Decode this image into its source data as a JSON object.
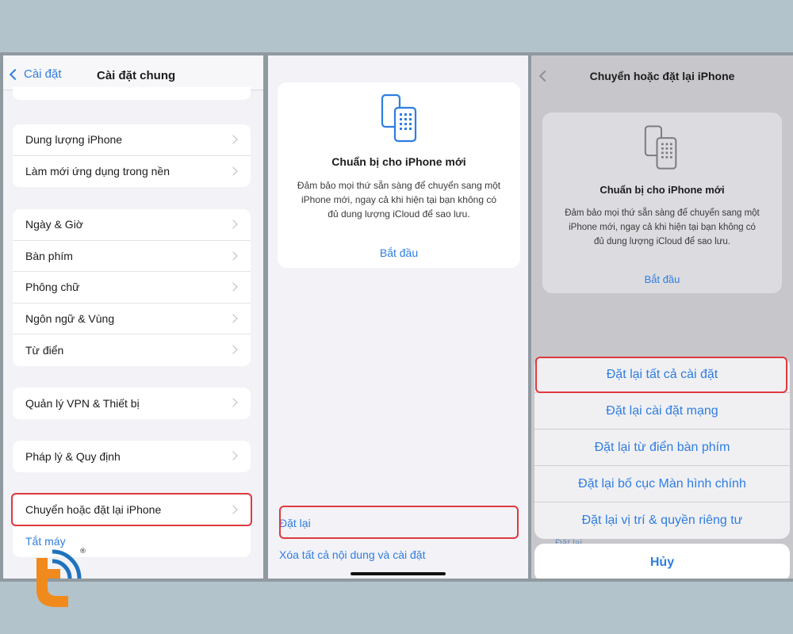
{
  "panel1": {
    "back_label": "Cài đặt",
    "title": "Cài đặt chung",
    "group1": [
      "Dung lượng iPhone",
      "Làm mới ứng dụng trong nền"
    ],
    "group2": [
      "Ngày & Giờ",
      "Bàn phím",
      "Phông chữ",
      "Ngôn ngữ & Vùng",
      "Từ điển"
    ],
    "group3": [
      "Quản lý VPN & Thiết bị"
    ],
    "group4": [
      "Pháp lý & Quy định"
    ],
    "group5": [
      "Chuyển hoặc đặt lại iPhone",
      "Tắt máy"
    ]
  },
  "panel2": {
    "card": {
      "title": "Chuẩn bị cho iPhone mới",
      "desc_line1": "Đảm bảo mọi thứ sẵn sàng để chuyển sang một",
      "desc_line2": "iPhone mới, ngay cả khi hiện tại bạn không có",
      "desc_line3": "đủ dung lượng iCloud để sao lưu.",
      "link": "Bắt đầu"
    },
    "reset_label": "Đặt lại",
    "erase_label": "Xóa tất cả nội dung và cài đặt"
  },
  "panel3": {
    "title": "Chuyển hoặc đặt lại iPhone",
    "card": {
      "title": "Chuẩn bị cho iPhone mới",
      "desc_line1": "Đảm bảo mọi thứ sẵn sàng để chuyển sang một",
      "desc_line2": "iPhone mới, ngay cả khi hiện tại bạn không có",
      "desc_line3": "đủ dung lượng iCloud để sao lưu.",
      "link": "Bắt đầu"
    },
    "sheet": [
      "Đặt lại tất cả cài đặt",
      "Đặt lại cài đặt mạng",
      "Đặt lại từ điển bàn phím",
      "Đặt lại bố cục Màn hình chính",
      "Đặt lại vị trí & quyền riêng tư"
    ],
    "peek_label": "Đặt lại",
    "cancel_label": "Hủy"
  },
  "logo": {
    "icon": "brand-logo-icon",
    "mark": "®"
  },
  "colors": {
    "accent": "#2f7de1",
    "highlight": "#e0393e",
    "logo_orange": "#f08a1c",
    "logo_blue": "#1e73be"
  }
}
